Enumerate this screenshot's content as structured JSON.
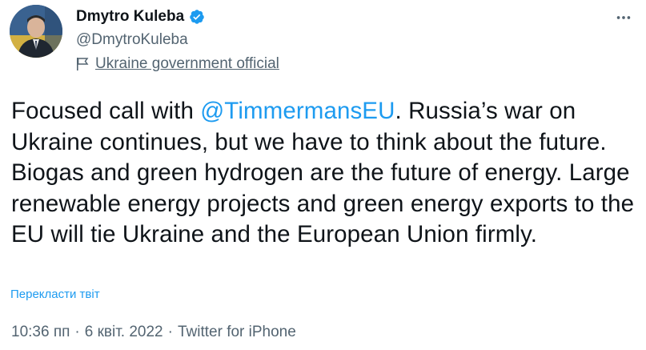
{
  "author": {
    "display_name": "Dmytro Kuleba",
    "handle": "@DmytroKuleba",
    "affiliation": "Ukraine government official",
    "verified_color": "#1d9bf0"
  },
  "icons": {
    "verified": "verified-badge-icon",
    "affiliation": "flag-icon",
    "more": "more-horizontal-icon"
  },
  "tweet": {
    "text_before_mention": "Focused call with ",
    "mention": "@TimmermansEU",
    "text_after_mention": ". Russia’s war on Ukraine continues, but we have to think about the future. Biogas and green hydrogen are the future of energy. Large renewable energy projects and green energy exports to the EU will tie Ukraine and the European Union firmly.",
    "translate_label": "Перекласти твіт",
    "time": "10:36 пп",
    "date": "6 квіт. 2022",
    "source": "Twitter for iPhone",
    "separator": "·"
  },
  "colors": {
    "link": "#1d9bf0",
    "secondary_text": "#536471",
    "primary_text": "#0f1419"
  }
}
